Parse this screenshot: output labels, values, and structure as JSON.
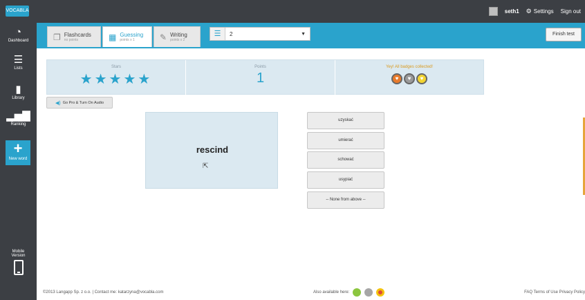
{
  "app": {
    "logo": "VOCABLA"
  },
  "topbar": {
    "username": "seth1",
    "settings_label": "Settings",
    "signout_label": "Sign out"
  },
  "sidebar": {
    "items": [
      {
        "label": "Dashboard",
        "icon": "gauge-icon"
      },
      {
        "label": "Lists",
        "icon": "list-icon"
      },
      {
        "label": "Library",
        "icon": "library-icon"
      },
      {
        "label": "Ranking",
        "icon": "ranking-icon"
      }
    ],
    "new_word_label": "New word",
    "mobile_label_1": "Mobile",
    "mobile_label_2": "Version"
  },
  "modes": {
    "tabs": [
      {
        "title": "Flashcards",
        "sub": "no points",
        "icon": "flashcards-icon",
        "active": false
      },
      {
        "title": "Guessing",
        "sub": "points x 1",
        "icon": "guessing-icon",
        "active": true
      },
      {
        "title": "Writing",
        "sub": "points x 2",
        "icon": "writing-icon",
        "active": false
      }
    ],
    "list_value": "2",
    "finish_label": "Finish test"
  },
  "stats": {
    "stars_label": "Stars",
    "stars": "★★★★★",
    "points_label": "Points",
    "points": "1",
    "badges_label": "Yey! All badges collected!",
    "badge_colors": [
      "#e87b2c",
      "#9a9a9a",
      "#f2d431"
    ]
  },
  "audio": {
    "label": "Go Pro & Turn On Audio"
  },
  "card": {
    "word": "rescind"
  },
  "answers": [
    "uzyskać",
    "umierać",
    "schować",
    "usypiać",
    "-- None from above --"
  ],
  "footer": {
    "copyright": "©2013 Langapp Sp. z o.o. | Contact me: katarzyna@vocabla.com",
    "available": "Also available here:",
    "links": "FAQ Terms of Use Privacy Policy"
  },
  "colors": {
    "accent": "#2aa3cc",
    "dark": "#3c3f44",
    "panel": "#dbe9f1",
    "badge_text": "#d99a1f"
  }
}
